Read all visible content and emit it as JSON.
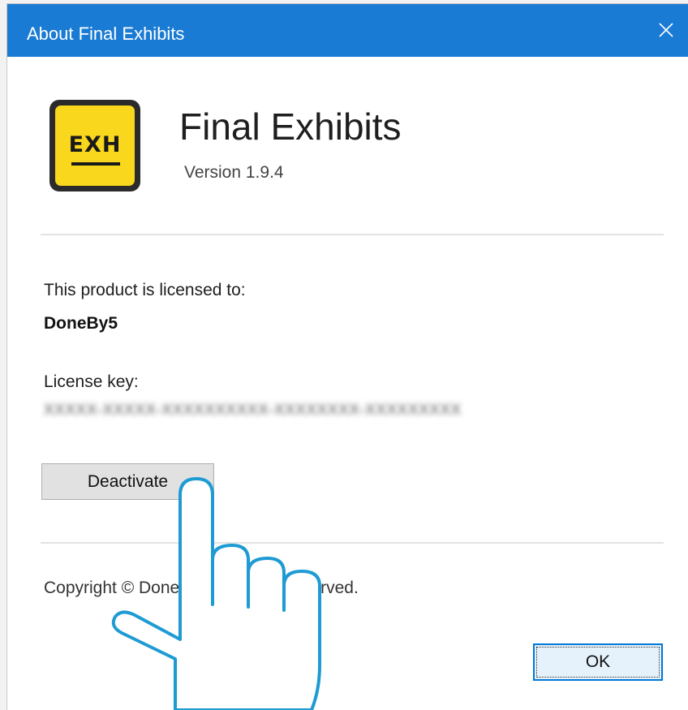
{
  "window": {
    "title": "About Final Exhibits",
    "close_icon": "close-icon",
    "titlebar_color": "#1a7bd4"
  },
  "app": {
    "icon_text": "EXH",
    "icon_color": "#f8d71c",
    "name": "Final Exhibits",
    "version": "Version 1.9.4"
  },
  "license": {
    "licensed_to_label": "This product is licensed to:",
    "licensee": "DoneBy5",
    "key_label": "License key:",
    "key_value_obscured": "XXXXX-XXXXX-XXXXXXXXXX-XXXXXXXX-XXXXXXXXX"
  },
  "buttons": {
    "deactivate_label": "Deactivate",
    "ok_label": "OK"
  },
  "footer": {
    "copyright": "Copyright © DoneBy5. All rights reserved."
  },
  "overlay": {
    "pointer_icon": "hand-pointer-icon"
  }
}
